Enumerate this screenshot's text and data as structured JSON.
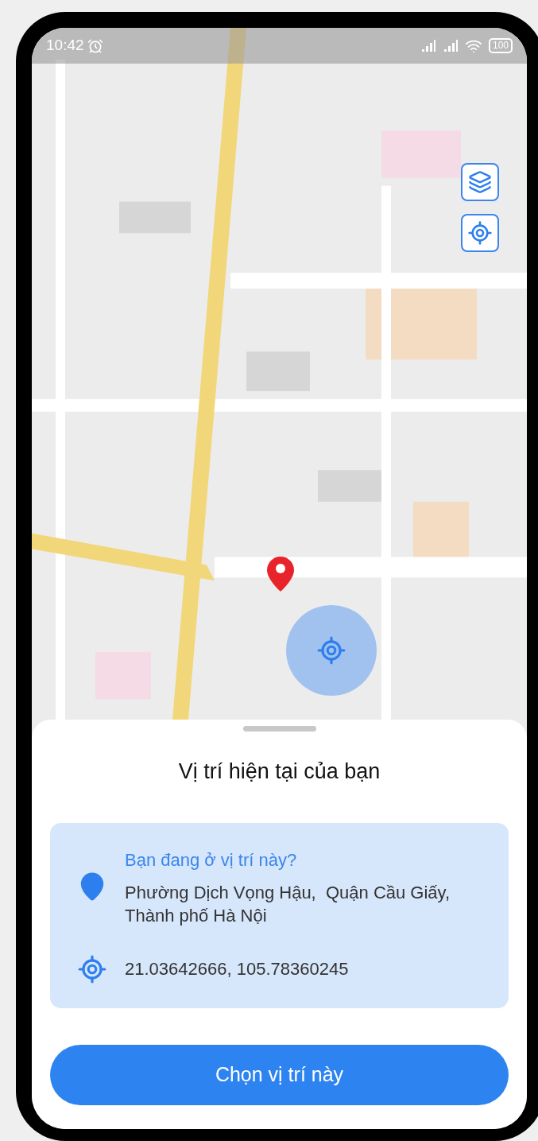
{
  "status_bar": {
    "time": "10:42",
    "battery": "100"
  },
  "sheet": {
    "title": "Vị trí hiện tại của bạn",
    "card": {
      "question": "Bạn đang ở vị trí này?",
      "address": "Phường Dịch Vọng Hậu,  Quận Cầu Giấy, Thành phố Hà Nội",
      "coordinates": "21.03642666, 105.78360245"
    },
    "button": "Chọn vị trí này"
  }
}
